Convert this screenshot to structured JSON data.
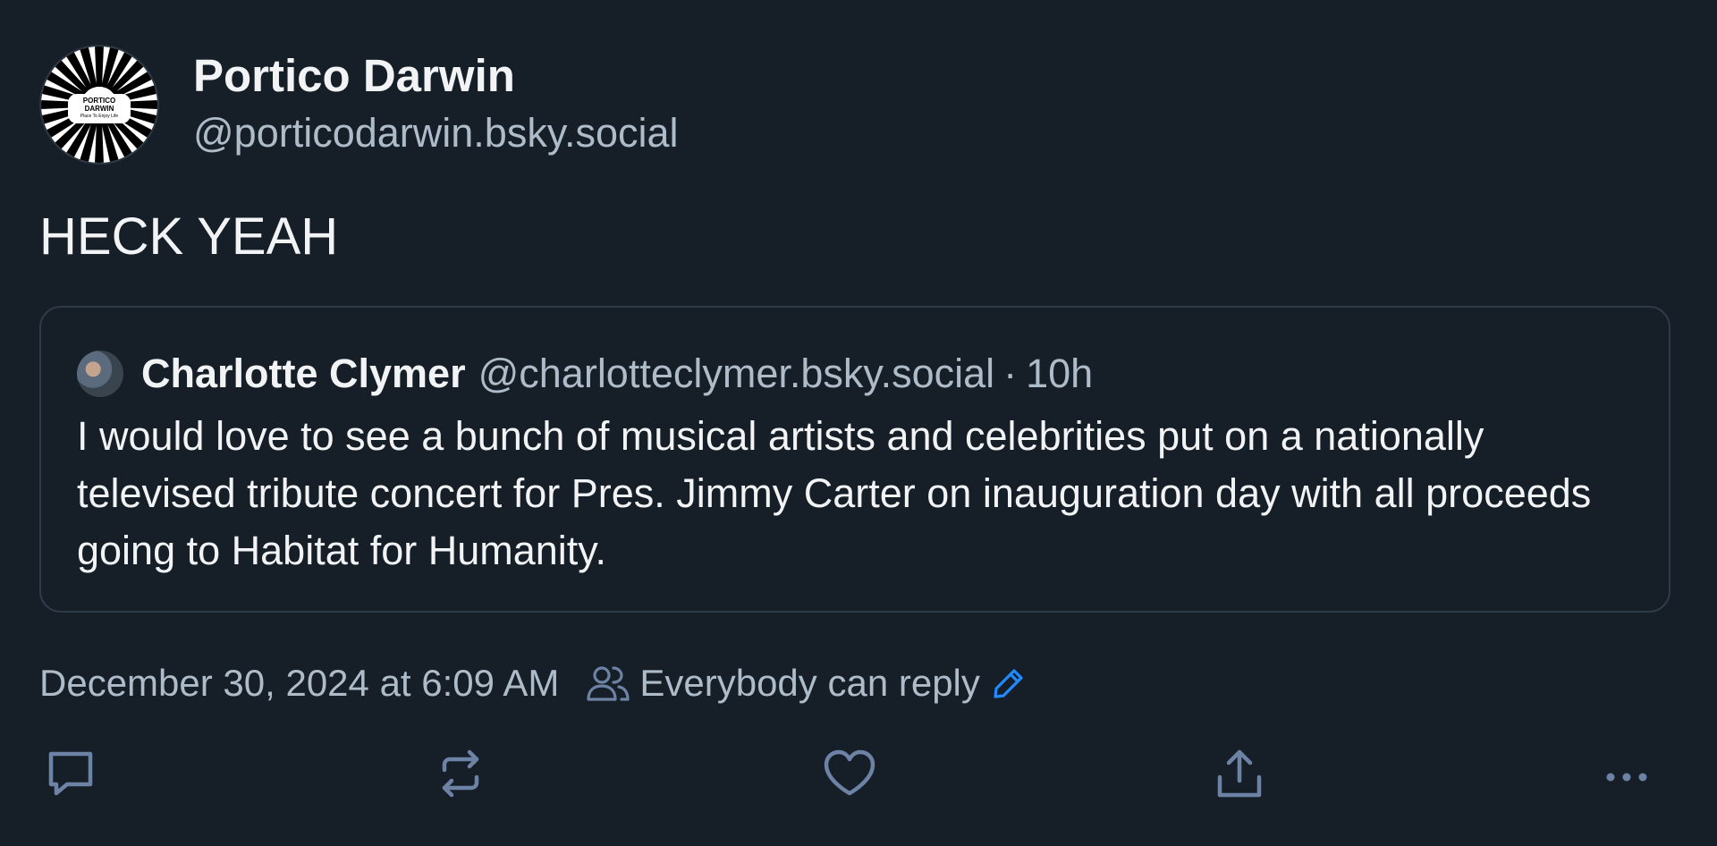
{
  "post": {
    "author": {
      "display_name": "Portico Darwin",
      "handle": "@porticodarwin.bsky.social",
      "avatar_text": "PORTICO DARWIN",
      "avatar_subtext": "Place To Enjoy Life"
    },
    "text": "HECK YEAH",
    "quote": {
      "display_name": "Charlotte Clymer",
      "handle": "@charlotteclymer.bsky.social",
      "separator": "·",
      "time": "10h",
      "text": "I would love to see a bunch of musical artists and celebrities put on a nationally televised tribute concert for Pres. Jimmy Carter on inauguration day with all proceeds going to Habitat for Humanity."
    },
    "timestamp": "December 30, 2024 at 6:09 AM",
    "reply_setting": "Everybody can reply"
  },
  "icons": {
    "people": "people-icon",
    "edit": "pencil-icon",
    "reply": "reply-bubble-icon",
    "repost": "repost-icon",
    "like": "heart-icon",
    "share": "share-icon",
    "more": "more-horizontal-icon"
  },
  "colors": {
    "background": "#161e27",
    "text": "#f1f3f5",
    "muted": "#aebbc9",
    "border": "#2e3b49",
    "accent": "#208bfe"
  }
}
